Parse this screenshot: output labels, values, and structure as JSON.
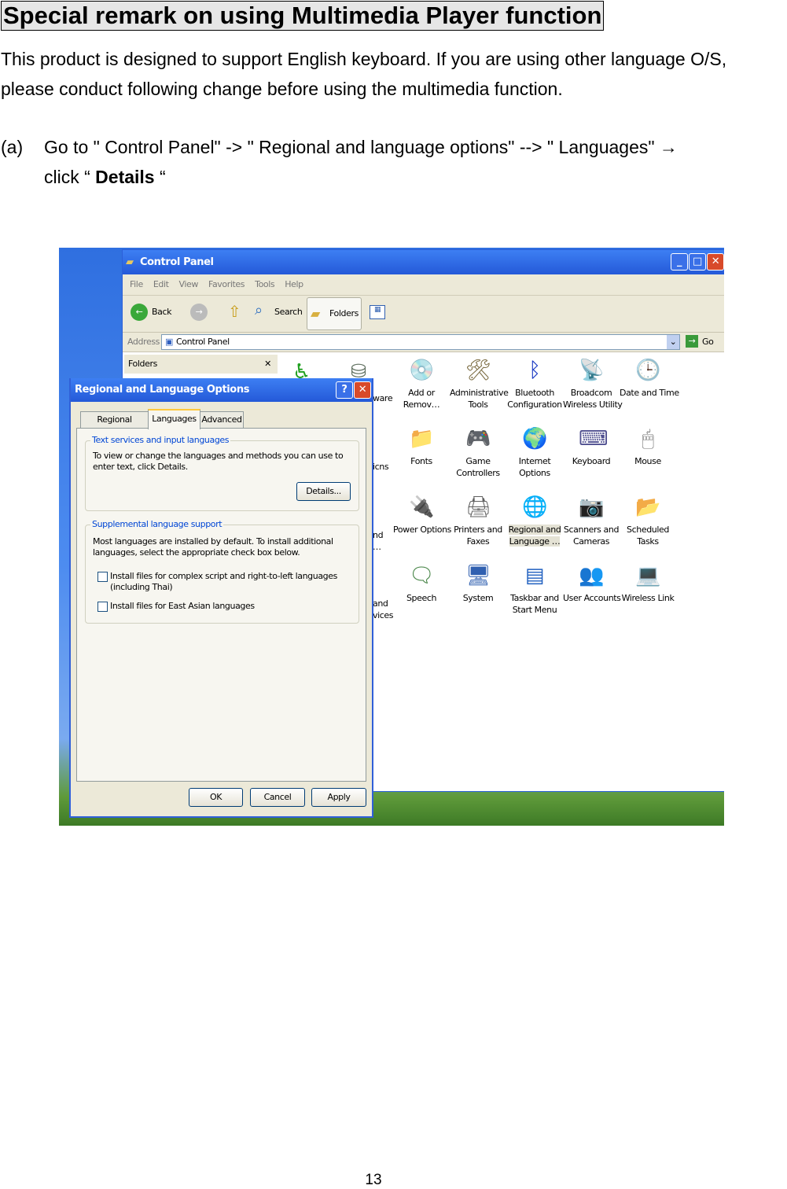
{
  "heading": "Special remark on using Multimedia Player function",
  "intro": [
    "This product is designed to support English keyboard. If you are using other language O/S,",
    "please conduct following change before using the multimedia function."
  ],
  "step": {
    "marker": "(a)",
    "line1": "Go to \" Control Panel\" ->  \" Regional and language options\" --> \" Languages\"  →",
    "line2_prefix": "click “ ",
    "line2_bold": "Details",
    "line2_suffix": " “"
  },
  "screenshot": {
    "control_panel": {
      "title": "Control Panel",
      "menu": [
        "File",
        "Edit",
        "View",
        "Favorites",
        "Tools",
        "Help"
      ],
      "toolbar": {
        "back": "Back",
        "search": "Search",
        "folders": "Folders"
      },
      "address_label": "Address",
      "address_value": "Control Panel",
      "go": "Go",
      "folders_pane": "Folders",
      "partial_labels": [
        "ware",
        "icns",
        "nd\n…",
        "and\nvices"
      ],
      "icons": [
        {
          "label": "Add or\nRemov…",
          "icon": "add-remove-programs-icon",
          "glyph": "💿",
          "color": "#4a7fd0"
        },
        {
          "label": "Administrative\nTools",
          "icon": "administrative-tools-icon",
          "glyph": "🛠",
          "color": "#7a6a40"
        },
        {
          "label": "Bluetooth\nConfiguration",
          "icon": "bluetooth-icon",
          "glyph": "ᛒ",
          "color": "#1030c0"
        },
        {
          "label": "Broadcom\nWireless Utility",
          "icon": "wireless-utility-icon",
          "glyph": "📡",
          "color": "#c02020"
        },
        {
          "label": "Date and Time",
          "icon": "date-time-icon",
          "glyph": "🕒",
          "color": "#4080c0"
        },
        {
          "label": "Fonts",
          "icon": "fonts-icon",
          "glyph": "📁",
          "color": "#d0a020"
        },
        {
          "label": "Game\nControllers",
          "icon": "game-controller-icon",
          "glyph": "🎮",
          "color": "#6060b0"
        },
        {
          "label": "Internet\nOptions",
          "icon": "internet-options-icon",
          "glyph": "🌍",
          "color": "#2060b0"
        },
        {
          "label": "Keyboard",
          "icon": "keyboard-icon",
          "glyph": "⌨",
          "color": "#505090"
        },
        {
          "label": "Mouse",
          "icon": "mouse-icon",
          "glyph": "🖱",
          "color": "#707070"
        },
        {
          "label": "Power Options",
          "icon": "power-options-icon",
          "glyph": "🔌",
          "color": "#806040"
        },
        {
          "label": "Printers and\nFaxes",
          "icon": "printer-icon",
          "glyph": "🖨",
          "color": "#606060"
        },
        {
          "label": "Regional and\nLanguage …",
          "icon": "globe-icon",
          "glyph": "🌐",
          "color": "#2070c0",
          "selected": true
        },
        {
          "label": "Scanners and\nCameras",
          "icon": "scanner-camera-icon",
          "glyph": "📷",
          "color": "#606060"
        },
        {
          "label": "Scheduled\nTasks",
          "icon": "scheduled-tasks-icon",
          "glyph": "📂",
          "color": "#d0a020"
        },
        {
          "label": "Speech",
          "icon": "speech-icon",
          "glyph": "🗨",
          "color": "#408040"
        },
        {
          "label": "System",
          "icon": "system-icon",
          "glyph": "🖥",
          "color": "#3060b0"
        },
        {
          "label": "Taskbar and\nStart Menu",
          "icon": "taskbar-icon",
          "glyph": "▤",
          "color": "#2060c0"
        },
        {
          "label": "User Accounts",
          "icon": "user-accounts-icon",
          "glyph": "👥",
          "color": "#c06020"
        },
        {
          "label": "Wireless Link",
          "icon": "wireless-link-icon",
          "glyph": "💻",
          "color": "#3070c0"
        }
      ]
    },
    "dialog": {
      "title": "Regional and Language Options",
      "tabs": [
        "Regional Options",
        "Languages",
        "Advanced"
      ],
      "active_tab": "Languages",
      "group1": {
        "legend": "Text services and input languages",
        "text": "To view or change the languages and methods you can use to enter text, click Details.",
        "button": "Details..."
      },
      "group2": {
        "legend": "Supplemental language support",
        "text": "Most languages are installed by default. To install additional languages, select the appropriate check box below.",
        "checkboxes": [
          {
            "label": "Install files for complex script and right-to-left languages (including Thai)",
            "checked": false
          },
          {
            "label": "Install files for East Asian languages",
            "checked": false
          }
        ]
      },
      "buttons": [
        "OK",
        "Cancel",
        "Apply"
      ]
    }
  },
  "page_number": "13"
}
